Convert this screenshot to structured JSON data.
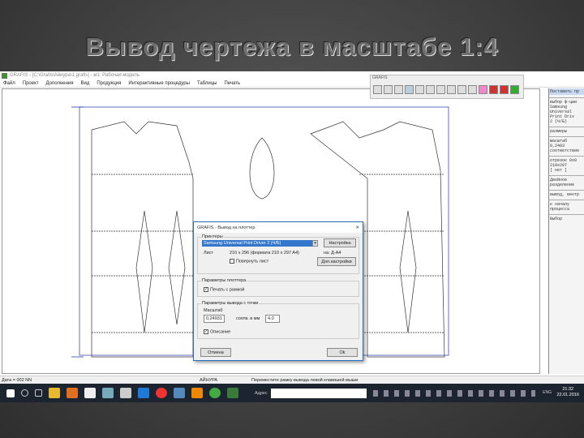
{
  "slide_title": "Вывод чертежа в масштабе 1:4",
  "window_title": "GRAFIS - [C:\\Grafis\\Айнура\\1.grafis] - м1: Рабочая модель",
  "menu": [
    "Файл",
    "Проект",
    "Дополнения",
    "Вид",
    "Продукция",
    "Интерактивные процедуры",
    "Таблицы",
    "Печать"
  ],
  "toolbar_title": "GRAFIS",
  "right_panel": {
    "header": "Поставить пр",
    "lines": [
      "выбор ф-ции",
      "Samsung",
      "Universal",
      "Print Driv",
      "2 (Ч/Б)",
      "размеры",
      "масштаб",
      "0,2493",
      "соответствие",
      "отрезок 0х0",
      "210x297",
      "[ нет ]",
      "Двойное",
      "разделение",
      "вывод, вентр",
      "к началу",
      "процесса",
      "Выбор"
    ]
  },
  "dialog": {
    "title": "GRAFIS - Вывод на плоттер",
    "group_printer": "Принтеры",
    "printer": "Samsung Universal Print Driver 2 (Ч/Б)",
    "setup": "Настройка",
    "sheet_label": "Лист",
    "sheet_value": "210 x 296 (формата 210 x 297 A4)",
    "on": "на: Д-А4",
    "rotate": "Повернуть лист",
    "extra": "Доп.настройки",
    "group_plotter": "Параметры плоттера",
    "frame": "Печать с рамкой",
    "group_output": "Параметры вывода с точки",
    "scale_label": "Масштаб",
    "scale_value": "0,24931",
    "mm_label": "соотв. в мм",
    "mm_value": "4.0",
    "desc": "Описание",
    "cancel": "Отмена",
    "ok": "Ok"
  },
  "status": {
    "left": "Дата = 002 NN",
    "user": "АЙНУРА",
    "hint": "Переместите рамку вывода левой клавишей мыши"
  },
  "taskbar": {
    "address_label": "Адрес",
    "lang": "ENG",
    "time": "21:32",
    "date": "22.01.2016"
  }
}
